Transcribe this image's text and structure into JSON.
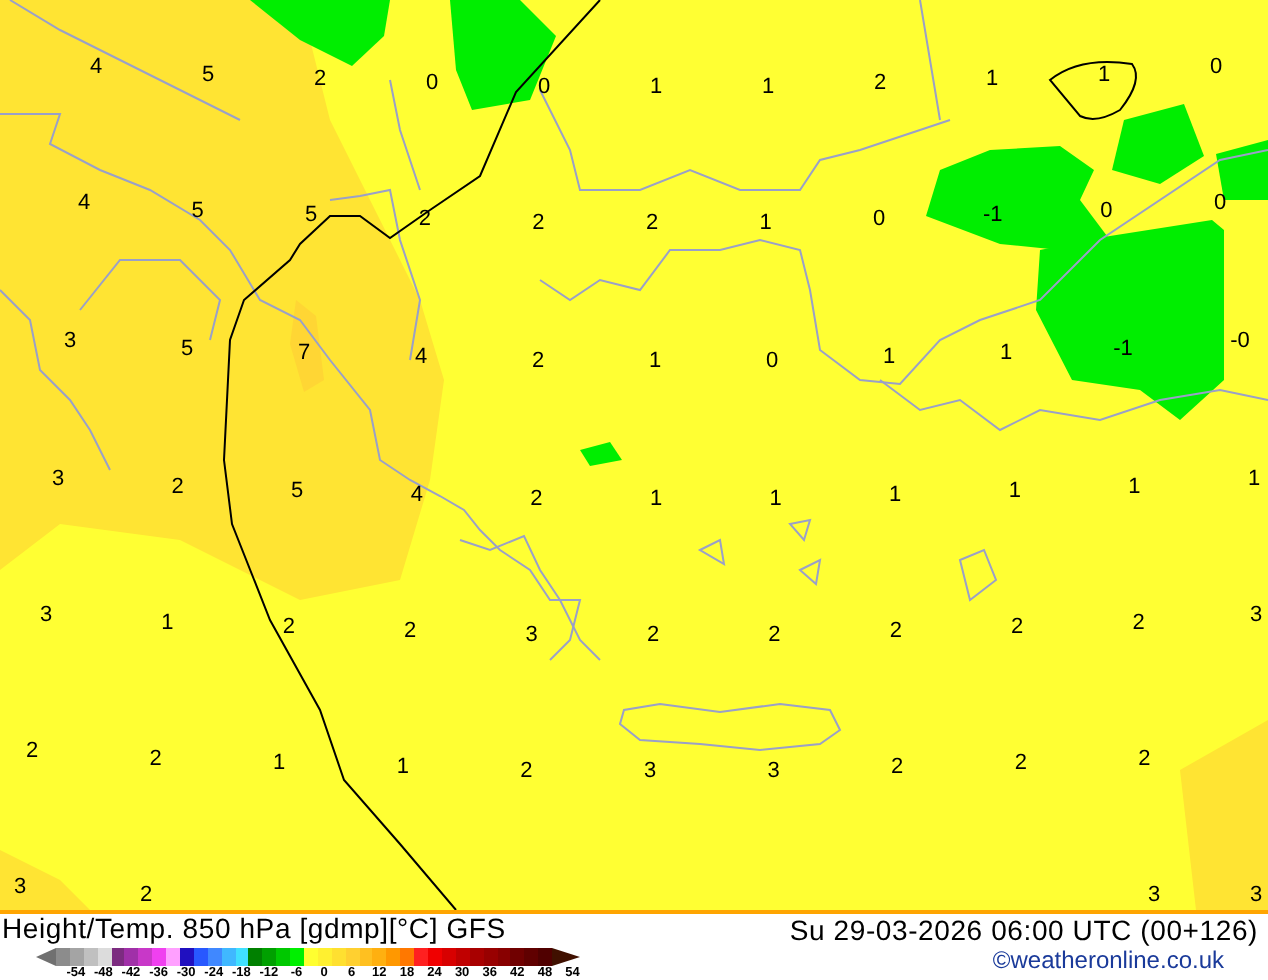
{
  "map": {
    "grid_labels": [
      [
        "4",
        "5",
        "2",
        "0",
        "0",
        "1",
        "1",
        "2",
        "1",
        "1",
        "0"
      ],
      [
        "4",
        "5",
        "5",
        "2",
        "2",
        "2",
        "1",
        "0",
        "-1",
        "0",
        "0"
      ],
      [
        "3",
        "5",
        "7",
        "4",
        "2",
        "1",
        "0",
        "1",
        "1",
        "-1",
        "-0"
      ],
      [
        "3",
        "2",
        "5",
        "4",
        "2",
        "1",
        "1",
        "1",
        "1",
        "1",
        "1"
      ],
      [
        "3",
        "1",
        "2",
        "2",
        "3",
        "2",
        "2",
        "2",
        "2",
        "2",
        "3"
      ],
      [
        "2",
        "2",
        "1",
        "1",
        "2",
        "3",
        "3",
        "2",
        "2",
        "2"
      ],
      [
        "3",
        "2"
      ]
    ],
    "bottom_right_labels": [
      "3",
      "3"
    ]
  },
  "footer": {
    "title": "Height/Temp. 850 hPa [gdmp][°C] GFS",
    "valid_time": "Su 29-03-2026 06:00 UTC (00+126)",
    "credit": "©weatheronline.co.uk"
  },
  "legend": {
    "swatches": [
      {
        "kind": "end-low",
        "color": "#707070"
      },
      {
        "kind": "band",
        "color": "#8c8c8c"
      },
      {
        "kind": "band",
        "color": "#a4a4a4"
      },
      {
        "kind": "band",
        "color": "#c0c0c0"
      },
      {
        "kind": "band",
        "color": "#dcdcdc"
      },
      {
        "kind": "band",
        "color": "#7c2c80"
      },
      {
        "kind": "band",
        "color": "#a030a8"
      },
      {
        "kind": "band",
        "color": "#c838c8"
      },
      {
        "kind": "band",
        "color": "#f040f0"
      },
      {
        "kind": "band",
        "color": "#ffa0ff"
      },
      {
        "kind": "band",
        "color": "#2010c0"
      },
      {
        "kind": "band",
        "color": "#2858ff"
      },
      {
        "kind": "band",
        "color": "#4088ff"
      },
      {
        "kind": "band",
        "color": "#40b8ff"
      },
      {
        "kind": "band",
        "color": "#40e0ff"
      },
      {
        "kind": "band",
        "color": "#008000"
      },
      {
        "kind": "band",
        "color": "#00a000"
      },
      {
        "kind": "band",
        "color": "#00c800"
      },
      {
        "kind": "band",
        "color": "#00f000"
      },
      {
        "kind": "band",
        "color": "#ffff30"
      },
      {
        "kind": "band",
        "color": "#fff030"
      },
      {
        "kind": "band",
        "color": "#ffe030"
      },
      {
        "kind": "band",
        "color": "#ffd030"
      },
      {
        "kind": "band",
        "color": "#ffc020"
      },
      {
        "kind": "band",
        "color": "#ffb010"
      },
      {
        "kind": "band",
        "color": "#ff9800"
      },
      {
        "kind": "band",
        "color": "#ff7800"
      },
      {
        "kind": "band",
        "color": "#ff2020"
      },
      {
        "kind": "band",
        "color": "#f00000"
      },
      {
        "kind": "band",
        "color": "#d80000"
      },
      {
        "kind": "band",
        "color": "#c00000"
      },
      {
        "kind": "band",
        "color": "#a80000"
      },
      {
        "kind": "band",
        "color": "#980000"
      },
      {
        "kind": "band",
        "color": "#880000"
      },
      {
        "kind": "band",
        "color": "#700000"
      },
      {
        "kind": "band",
        "color": "#600000"
      },
      {
        "kind": "band",
        "color": "#500000"
      },
      {
        "kind": "end-high",
        "color": "#401000"
      }
    ],
    "ticks": [
      "-54",
      "-48",
      "-42",
      "-36",
      "-30",
      "-24",
      "-18",
      "-12",
      "-6",
      "0",
      "6",
      "12",
      "18",
      "24",
      "30",
      "36",
      "42",
      "48",
      "54"
    ]
  }
}
